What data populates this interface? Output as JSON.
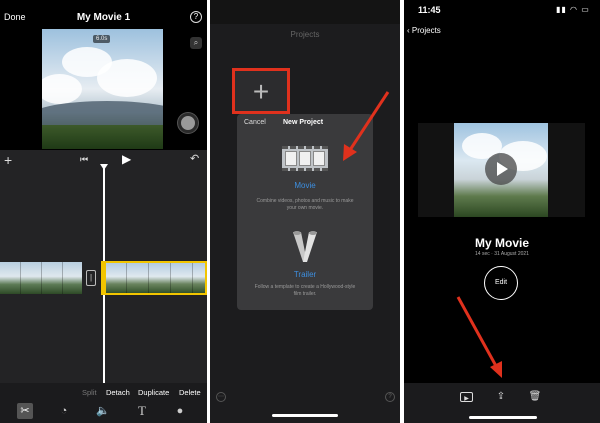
{
  "editor": {
    "done_label": "Done",
    "title": "My Movie 1",
    "help_icon": "?",
    "clip_duration": "6.0s",
    "actions": {
      "split": "Split",
      "detach": "Detach",
      "duplicate": "Duplicate",
      "delete": "Delete"
    },
    "tools": [
      "scissors-icon",
      "speed-icon",
      "volume-icon",
      "text-icon",
      "filters-icon"
    ]
  },
  "projects_screen": {
    "title": "Projects",
    "modal": {
      "cancel_label": "Cancel",
      "title": "New Project",
      "movie_label": "Movie",
      "movie_desc": "Combine videos, photos and music to make your own movie.",
      "trailer_label": "Trailer",
      "trailer_desc": "Follow a template to create a Hollywood-style film trailer."
    }
  },
  "project_detail": {
    "status_time": "11:45",
    "back_label": "Projects",
    "movie_name": "My Movie",
    "movie_meta": "14 sec · 31 August 2021",
    "edit_label": "Edit"
  },
  "colors": {
    "highlight_red": "#e0311d",
    "accent_blue": "#3d8fe0",
    "clip_select_yellow": "#f2c500"
  }
}
